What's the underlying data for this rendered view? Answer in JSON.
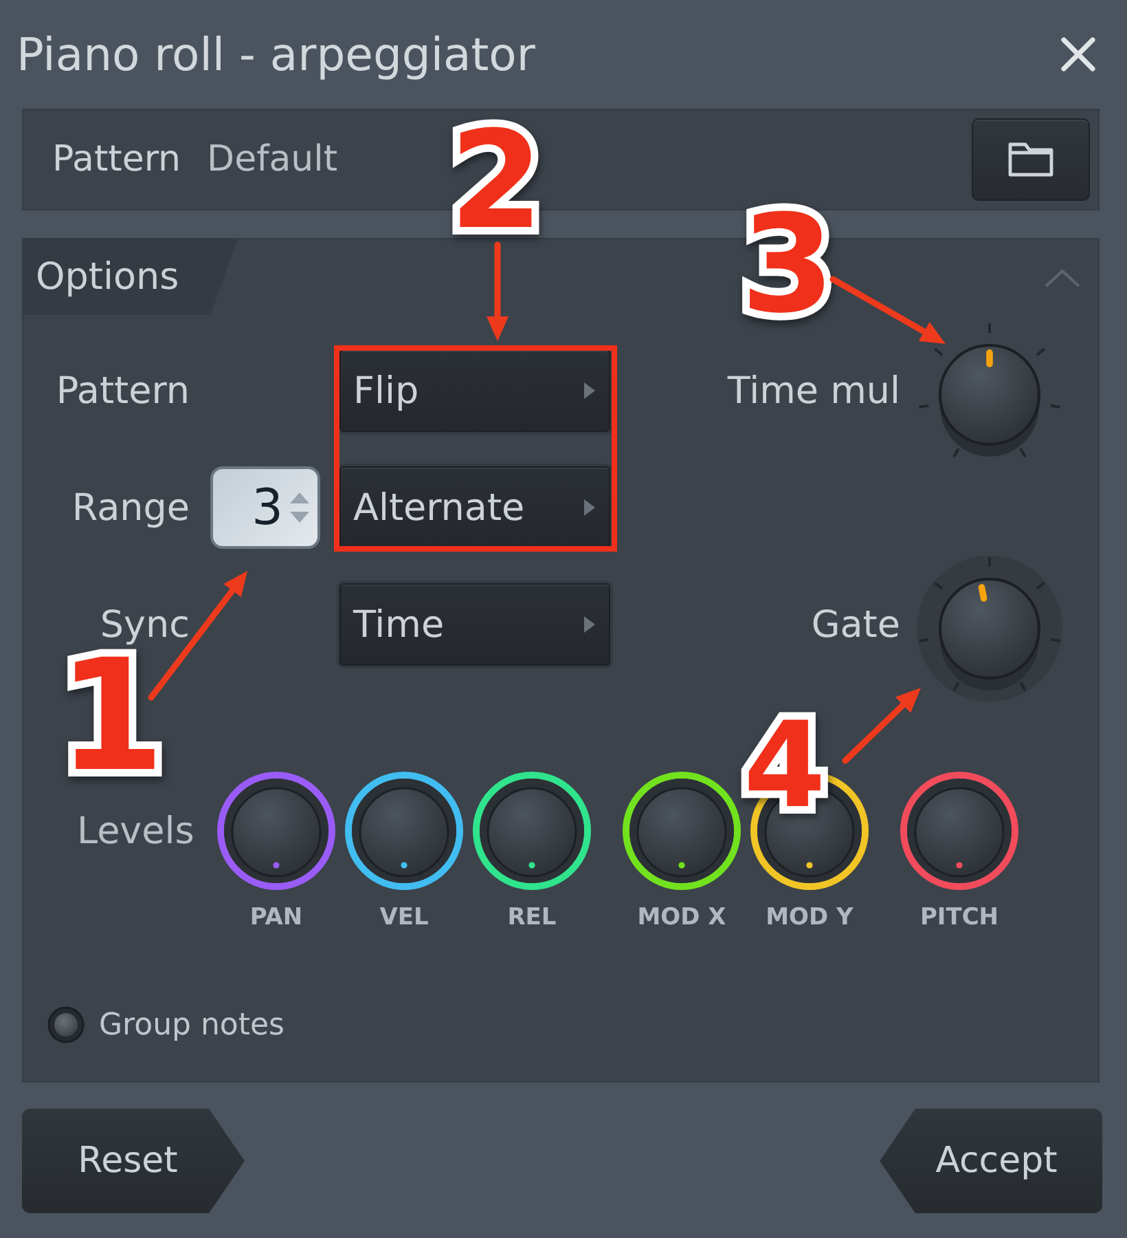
{
  "window": {
    "title": "Piano roll - arpeggiator"
  },
  "preset": {
    "label": "Pattern",
    "value": "Default"
  },
  "options": {
    "title": "Options",
    "rows": [
      {
        "label": "Pattern",
        "controls": [
          {
            "kind": "dropdown",
            "value": "Flip"
          }
        ]
      },
      {
        "label": "Range",
        "controls": [
          {
            "kind": "spinner",
            "value": "3"
          },
          {
            "kind": "dropdown",
            "value": "Alternate"
          }
        ]
      },
      {
        "label": "Sync",
        "controls": [
          {
            "kind": "dropdown",
            "value": "Time"
          }
        ]
      }
    ],
    "knobs": [
      {
        "label": "Time mul",
        "level": 0.5
      },
      {
        "label": "Gate",
        "level": 0.46
      }
    ],
    "levels": {
      "label": "Levels",
      "groups": [
        [
          {
            "label": "PAN",
            "color": "#9a5cf6"
          },
          {
            "label": "VEL",
            "color": "#41bdf2"
          },
          {
            "label": "REL",
            "color": "#2fe48c"
          }
        ],
        [
          {
            "label": "MOD X",
            "color": "#72e21e"
          },
          {
            "label": "MOD Y",
            "color": "#f2c526"
          }
        ],
        [
          {
            "label": "PITCH",
            "color": "#f24c5c"
          }
        ]
      ]
    },
    "group_notes": {
      "label": "Group notes",
      "checked": false
    }
  },
  "buttons": [
    {
      "label": "Reset"
    },
    {
      "label": "Accept"
    }
  ],
  "annotations": [
    {
      "label": "1"
    },
    {
      "label": "2"
    },
    {
      "label": "3"
    },
    {
      "label": "4"
    }
  ]
}
